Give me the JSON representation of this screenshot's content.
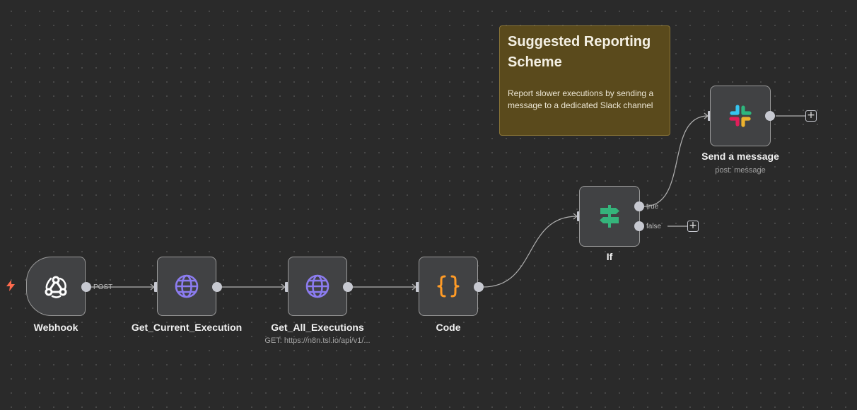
{
  "sticky_note": {
    "title": "Suggested Reporting Scheme",
    "body": "Report slower executions by sending a message to a dedicated Slack channel"
  },
  "nodes": {
    "webhook": {
      "label": "Webhook",
      "output_label": "POST",
      "icon": "webhook-icon"
    },
    "get_current": {
      "label": "Get_Current_Execution",
      "icon": "globe-icon"
    },
    "get_all": {
      "label": "Get_All_Executions",
      "subtitle": "GET: https://n8n.tsl.io/api/v1/...",
      "icon": "globe-icon"
    },
    "code": {
      "label": "Code",
      "icon": "braces-icon"
    },
    "if": {
      "label": "If",
      "true_label": "true",
      "false_label": "false",
      "icon": "signpost-icon"
    },
    "slack": {
      "label": "Send a message",
      "subtitle": "post: message",
      "icon": "slack-icon"
    }
  },
  "colors": {
    "canvas_bg": "#2a2a2a",
    "node_bg": "#414244",
    "handle": "#c7c9d1",
    "trigger_accent": "#ff6a4d",
    "http_icon": "#8c7cf0",
    "code_icon": "#ff9b26",
    "if_icon": "#35b47b",
    "sticky_bg": "#5a4a1c"
  }
}
